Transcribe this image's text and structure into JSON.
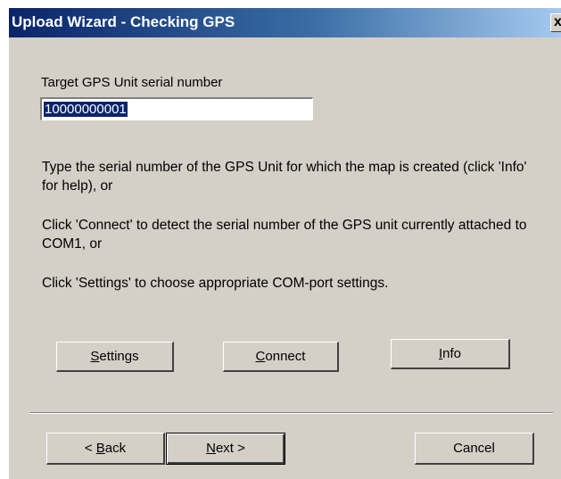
{
  "window": {
    "title": "Upload Wizard - Checking GPS",
    "close_label": "x"
  },
  "serial": {
    "label": "Target GPS Unit serial number",
    "value": "10000000001"
  },
  "instructions": [
    "Type the serial number of the GPS Unit for which the map is created (click 'Info' for help), or",
    "Click 'Connect' to detect the serial number of the GPS unit currently attached to COM1, or",
    "Click 'Settings' to choose appropriate COM-port settings."
  ],
  "actions": {
    "settings": {
      "mnemonic": "S",
      "rest": "ettings"
    },
    "connect": {
      "mnemonic": "C",
      "rest": "onnect"
    },
    "info": {
      "mnemonic": "I",
      "rest": "nfo"
    }
  },
  "nav": {
    "back": {
      "prefix": "< ",
      "mnemonic": "B",
      "rest": "ack"
    },
    "next": {
      "mnemonic": "N",
      "rest": "ext >"
    },
    "cancel": "Cancel"
  }
}
